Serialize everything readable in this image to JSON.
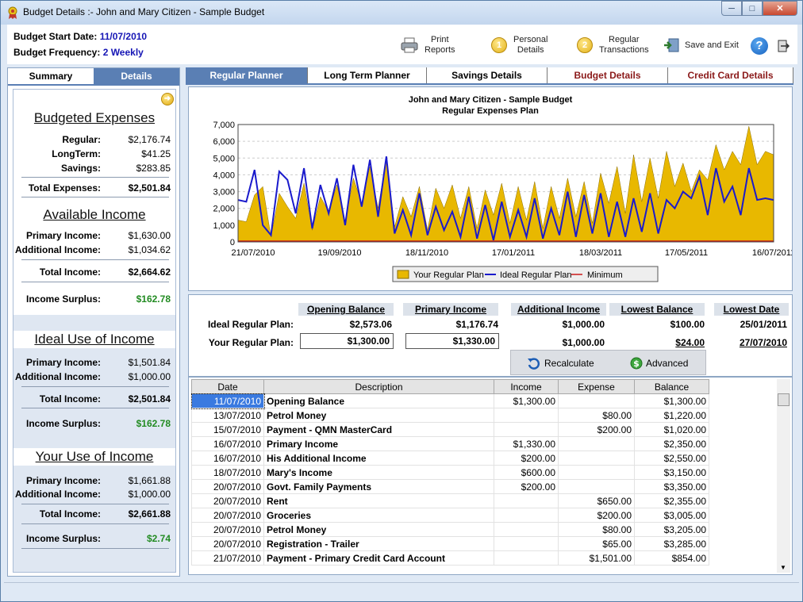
{
  "window": {
    "title": "Budget Details :- John and Mary Citizen - Sample Budget"
  },
  "header": {
    "start_label": "Budget Start Date:",
    "start_value": "11/07/2010",
    "freq_label": "Budget Frequency:",
    "freq_value": "2 Weekly",
    "print_line1": "Print",
    "print_line2": "Reports",
    "personal_line1": "Personal",
    "personal_line2": "Details",
    "regular_line1": "Regular",
    "regular_line2": "Transactions",
    "save_exit": "Save and Exit",
    "personal_num": "1",
    "regular_num": "2",
    "help": "?"
  },
  "left_tabs": {
    "summary": "Summary",
    "details": "Details"
  },
  "summary": {
    "budgeted_title": "Budgeted Expenses",
    "regular_label": "Regular:",
    "regular_value": "$2,176.74",
    "longterm_label": "LongTerm:",
    "longterm_value": "$41.25",
    "savings_label": "Savings:",
    "savings_value": "$283.85",
    "total_exp_label": "Total Expenses:",
    "total_exp_value": "$2,501.84",
    "avail_title": "Available Income",
    "primary_label": "Primary Income:",
    "primary_value": "$1,630.00",
    "additional_label": "Additional Income:",
    "additional_value": "$1,034.62",
    "total_inc_label": "Total Income:",
    "total_inc_value": "$2,664.62",
    "surplus_label": "Income Surplus:",
    "surplus_value": "$162.78",
    "ideal_title": "Ideal Use of Income",
    "ideal_primary_value": "$1,501.84",
    "ideal_additional_value": "$1,000.00",
    "ideal_total_value": "$2,501.84",
    "ideal_surplus_value": "$162.78",
    "your_title": "Your Use of Income",
    "your_primary_value": "$1,661.88",
    "your_additional_value": "$1,000.00",
    "your_total_value": "$2,661.88",
    "your_surplus_value": "$2.74"
  },
  "main_tabs": [
    "Regular Planner",
    "Long Term Planner",
    "Savings Details",
    "Budget Details",
    "Credit Card Details"
  ],
  "chart_data": {
    "type": "area",
    "title": "John and Mary Citizen - Sample Budget",
    "subtitle": "Regular Expenses Plan",
    "ylim": [
      0,
      7000
    ],
    "yticks": [
      "0",
      "1,000",
      "2,000",
      "3,000",
      "4,000",
      "5,000",
      "6,000",
      "7,000"
    ],
    "xticks": [
      "21/07/2010",
      "19/09/2010",
      "18/11/2010",
      "17/01/2011",
      "18/03/2011",
      "17/05/2011",
      "16/07/2011"
    ],
    "series": [
      {
        "name": "Your Regular Plan",
        "color": "#e8b800",
        "values": [
          1300,
          1200,
          2800,
          3300,
          300,
          2900,
          2100,
          1400,
          3500,
          700,
          2700,
          1800,
          3400,
          1200,
          3800,
          2300,
          4500,
          2000,
          5000,
          900,
          2700,
          1500,
          3300,
          700,
          3200,
          2000,
          3400,
          1400,
          3300,
          800,
          3100,
          1600,
          3500,
          1100,
          3300,
          1300,
          3600,
          800,
          3300,
          1400,
          3800,
          1500,
          3600,
          1100,
          4100,
          2300,
          4500,
          1700,
          5200,
          2400,
          5000,
          2600,
          5400,
          3300,
          4700,
          3000,
          4300,
          3700,
          5800,
          4300,
          5400,
          4600,
          6900,
          4600,
          5400,
          5200
        ]
      },
      {
        "name": "Ideal Regular Plan",
        "color": "#1a1acc",
        "values": [
          2500,
          2400,
          4300,
          1000,
          400,
          4200,
          3700,
          1700,
          4400,
          800,
          3400,
          1700,
          3800,
          1000,
          4600,
          2100,
          4900,
          1500,
          5100,
          500,
          1900,
          400,
          2900,
          400,
          2100,
          700,
          1800,
          300,
          2700,
          200,
          2200,
          100,
          2400,
          300,
          1900,
          300,
          2600,
          200,
          2000,
          400,
          3000,
          300,
          2800,
          500,
          2900,
          300,
          2400,
          300,
          2600,
          600,
          2900,
          500,
          2500,
          2000,
          3000,
          2600,
          3900,
          1600,
          4400,
          2400,
          3300,
          1600,
          4400,
          2500,
          2600,
          2500
        ]
      },
      {
        "name": "Minimum",
        "color": "#cc1a1a",
        "values": []
      }
    ]
  },
  "plan": {
    "headers": [
      "Opening Balance",
      "Primary Income",
      "Additional Income",
      "Lowest Balance",
      "Lowest Date"
    ],
    "ideal_label": "Ideal Regular Plan:",
    "ideal_values": [
      "$2,573.06",
      "$1,176.74",
      "$1,000.00",
      "$100.00",
      "25/01/2011"
    ],
    "your_label": "Your Regular Plan:",
    "your_values": [
      "$1,300.00",
      "$1,330.00",
      "$1,000.00",
      "$24.00",
      "27/07/2010"
    ],
    "recalc": "Recalculate",
    "advanced": "Advanced"
  },
  "table": {
    "columns": [
      "Date",
      "Description",
      "Income",
      "Expense",
      "Balance"
    ],
    "rows": [
      [
        "11/07/2010",
        "Opening Balance",
        "$1,300.00",
        "",
        "$1,300.00"
      ],
      [
        "13/07/2010",
        "Petrol Money",
        "",
        "$80.00",
        "$1,220.00"
      ],
      [
        "15/07/2010",
        "Payment - QMN MasterCard",
        "",
        "$200.00",
        "$1,020.00"
      ],
      [
        "16/07/2010",
        "Primary Income",
        "$1,330.00",
        "",
        "$2,350.00"
      ],
      [
        "16/07/2010",
        "His Additional Income",
        "$200.00",
        "",
        "$2,550.00"
      ],
      [
        "18/07/2010",
        "Mary's Income",
        "$600.00",
        "",
        "$3,150.00"
      ],
      [
        "20/07/2010",
        "Govt. Family Payments",
        "$200.00",
        "",
        "$3,350.00"
      ],
      [
        "20/07/2010",
        "Rent",
        "",
        "$650.00",
        "$2,355.00"
      ],
      [
        "20/07/2010",
        "Groceries",
        "",
        "$200.00",
        "$3,005.00"
      ],
      [
        "20/07/2010",
        "Petrol Money",
        "",
        "$80.00",
        "$3,205.00"
      ],
      [
        "20/07/2010",
        "Registration - Trailer",
        "",
        "$65.00",
        "$3,285.00"
      ],
      [
        "21/07/2010",
        "Payment - Primary Credit Card Account",
        "",
        "$1,501.00",
        "$854.00"
      ]
    ]
  }
}
